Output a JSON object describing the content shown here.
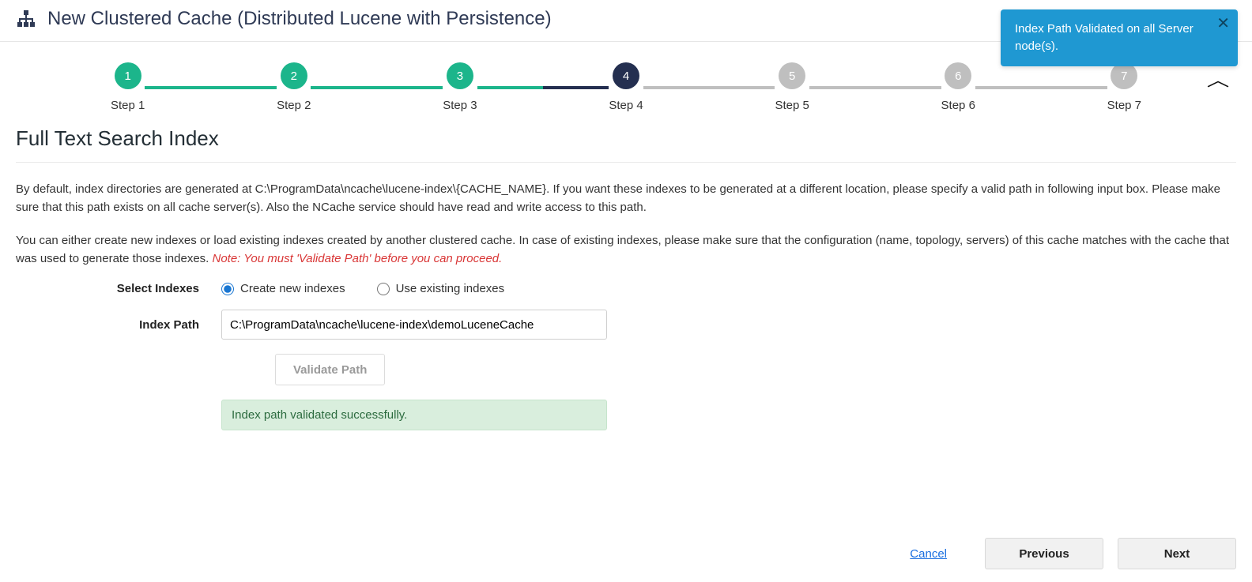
{
  "header": {
    "title": "New Clustered Cache (Distributed Lucene with Persistence)"
  },
  "toast": {
    "message": "Index Path Validated on all Server node(s)."
  },
  "stepper": {
    "steps": [
      {
        "num": "1",
        "label": "Step 1",
        "state": "done"
      },
      {
        "num": "2",
        "label": "Step 2",
        "state": "done"
      },
      {
        "num": "3",
        "label": "Step 3",
        "state": "done"
      },
      {
        "num": "4",
        "label": "Step 4",
        "state": "active"
      },
      {
        "num": "5",
        "label": "Step 5",
        "state": "future"
      },
      {
        "num": "6",
        "label": "Step 6",
        "state": "future"
      },
      {
        "num": "7",
        "label": "Step 7",
        "state": "future"
      }
    ]
  },
  "section": {
    "title": "Full Text Search Index",
    "p1": "By default, index directories are generated at C:\\ProgramData\\ncache\\lucene-index\\{CACHE_NAME}. If you want these indexes to be generated at a different location, please specify a valid path in following input box. Please make sure that this path exists on all cache server(s). Also the NCache service should have read and write access to this path.",
    "p2a": "You can either create new indexes or load existing indexes created by another clustered cache. In case of existing indexes, please make sure that the configuration (name, topology, servers) of this cache matches with the cache that was used to generate those indexes. ",
    "p2warn": "Note: You must 'Validate Path' before you can proceed."
  },
  "form": {
    "select_indexes_label": "Select Indexes",
    "radio_create": "Create new indexes",
    "radio_existing": "Use existing indexes",
    "radio_selected": "create",
    "index_path_label": "Index Path",
    "index_path_value": "C:\\ProgramData\\ncache\\lucene-index\\demoLuceneCache",
    "validate_label": "Validate Path",
    "validate_disabled": true,
    "success_msg": "Index path validated successfully."
  },
  "footer": {
    "cancel": "Cancel",
    "previous": "Previous",
    "next": "Next"
  }
}
